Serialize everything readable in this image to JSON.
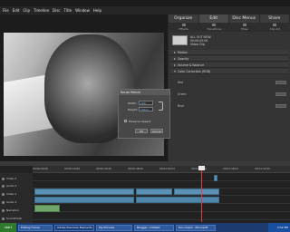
{
  "menubar": {
    "items": [
      "File",
      "Edit",
      "Clip",
      "Timeline",
      "Disc",
      "Title",
      "Window",
      "Help"
    ]
  },
  "panel": {
    "tabs": [
      "Organize",
      "Edit",
      "Disc Menus",
      "Share"
    ],
    "subtabs": [
      "Effects",
      "Transitions",
      "Titles",
      "Clip Art"
    ],
    "clip": {
      "name": "ALL OUT NOW",
      "meta1": "00;00;05;00",
      "meta2": "Video Clip"
    },
    "properties": [
      "Motion",
      "Opacity",
      "Volume & Balance",
      "Color Correction (RGB)"
    ],
    "subprops": [
      "Red",
      "Green",
      "Blue"
    ]
  },
  "dialog": {
    "title": "Resize Reticle",
    "width_label": "Width:",
    "width_value": "100",
    "height_label": "Height:",
    "height_value": "100.0",
    "check_label": "Preserve Aspect",
    "ok": "OK",
    "cancel": "Cancel"
  },
  "timeline": {
    "ticks": [
      "00;00;00;00",
      "00;00;16;00",
      "00;00;32;00",
      "00;00;48;00",
      "00;01;04;02",
      "00;01;20;02",
      "00;01;36;02",
      "00;01;52;02"
    ],
    "tracks": [
      "Video 2",
      "Audio 2",
      "Video 1",
      "Audio 1",
      "Narration",
      "Soundtrack"
    ]
  },
  "taskbar": {
    "start": "start",
    "tasks": [
      "Editing Frame",
      "Adobe Premiere Elements",
      "My Pictures",
      "Blogger: Untitled",
      "Document - Microsoft"
    ],
    "time": "3:52 PM"
  }
}
